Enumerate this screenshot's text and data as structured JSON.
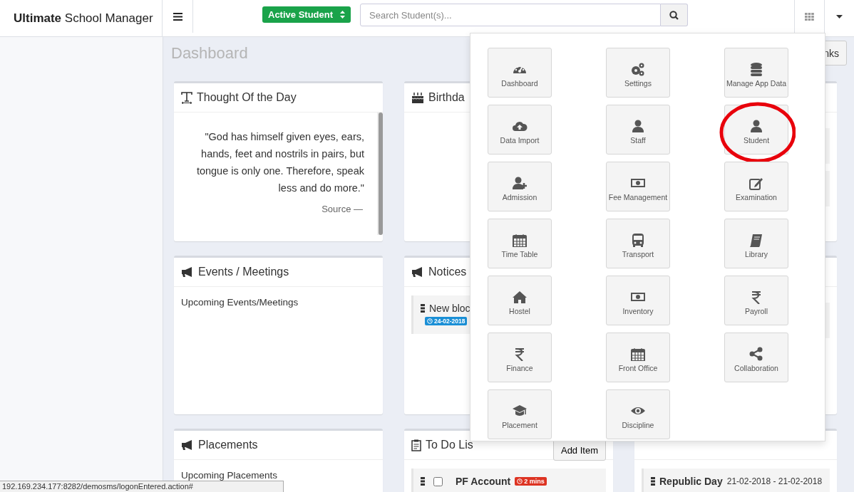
{
  "header": {
    "logo": "**Ultimate** School Manager",
    "student_filter": "Active Student",
    "search": {
      "placeholder": "Search Student(s)..."
    }
  },
  "page_title": "Dashboard",
  "quick_links_button": "nks",
  "thought": {
    "title": "Thought Of the Day",
    "quote": "\"God has himself given eyes, ears, hands, feet and nostrils in pairs, but tongue is only one. Therefore, speak less and do more.\"",
    "source": "Source —"
  },
  "birthdays": {
    "title": "Birthda"
  },
  "events": {
    "title": "Events / Meetings",
    "text": "Upcoming Events/Meetings"
  },
  "notices": {
    "title": "Notices",
    "items": [
      {
        "text": "New bloc",
        "date": "24-02-2018"
      }
    ]
  },
  "placements": {
    "title": "Placements",
    "text": "Upcoming Placements"
  },
  "todo": {
    "title": "To Do Lis",
    "add_button": "Add Item",
    "items": [
      {
        "text": "PF Account",
        "checked": false,
        "age": "2 mins"
      }
    ]
  },
  "holidays": {
    "items": [
      {
        "name": "Republic Day",
        "dates": "21-02-2018 - 21-02-2018"
      }
    ]
  },
  "app_menu": {
    "tiles": [
      {
        "label": "Dashboard",
        "highlighted": false
      },
      {
        "label": "Settings",
        "highlighted": false
      },
      {
        "label": "Manage App Data",
        "highlighted": false
      },
      {
        "label": "Data Import",
        "highlighted": false
      },
      {
        "label": "Staff",
        "highlighted": false
      },
      {
        "label": "Student",
        "highlighted": true
      },
      {
        "label": "Admission",
        "highlighted": false
      },
      {
        "label": "Fee Management",
        "highlighted": false
      },
      {
        "label": "Examination",
        "highlighted": false
      },
      {
        "label": "Time Table",
        "highlighted": false
      },
      {
        "label": "Transport",
        "highlighted": false
      },
      {
        "label": "Library",
        "highlighted": false
      },
      {
        "label": "Hostel",
        "highlighted": false
      },
      {
        "label": "Inventory",
        "highlighted": false
      },
      {
        "label": "Payroll",
        "highlighted": false
      },
      {
        "label": "Finance",
        "highlighted": false
      },
      {
        "label": "Front Office",
        "highlighted": false
      },
      {
        "label": "Collaboration",
        "highlighted": false
      },
      {
        "label": "Placement",
        "highlighted": false
      },
      {
        "label": "Discipline",
        "highlighted": false
      }
    ]
  },
  "status_url": "192.169.234.177:8282/demosms/logonEntered.action#"
}
